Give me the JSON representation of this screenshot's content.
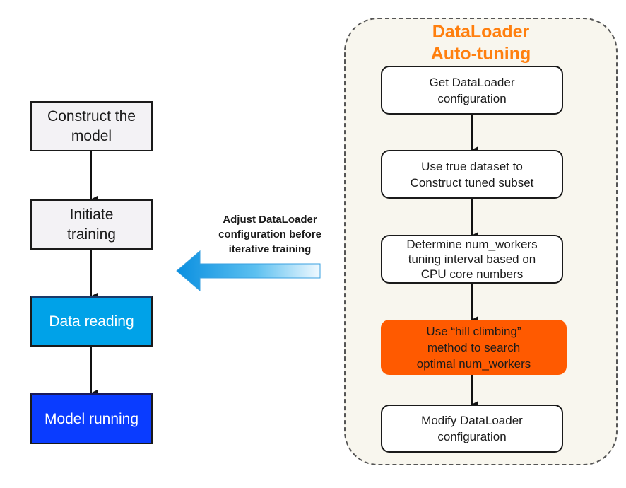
{
  "left_flow": {
    "steps": [
      {
        "label": "Construct the model",
        "style": "plain"
      },
      {
        "label": "Initiate training",
        "style": "plain"
      },
      {
        "label": "Data reading",
        "style": "cyan"
      },
      {
        "label": "Model running",
        "style": "blue"
      }
    ]
  },
  "connector": {
    "label": "Adjust DataLoader configuration before iterative training",
    "direction": "left"
  },
  "panel": {
    "title_line1": "DataLoader",
    "title_line2": "Auto-tuning",
    "steps": [
      {
        "line1": "Get DataLoader",
        "line2": "configuration"
      },
      {
        "line1": "Use true dataset to",
        "line2": "Construct tuned subset"
      },
      {
        "line1": "Determine num_workers",
        "line2": "tuning interval based on",
        "line3": "CPU core numbers"
      },
      {
        "line1": "Use “hill climbing”",
        "line2": "method to search",
        "line3": "optimal num_workers",
        "highlight": true
      },
      {
        "line1": "Modify DataLoader",
        "line2": "configuration"
      }
    ]
  },
  "colors": {
    "panel_title": "#ff7f0e",
    "highlight_step": "#ff5a00",
    "data_reading": "#00a2e8",
    "model_running": "#0a3cff",
    "panel_bg": "#f8f6ee"
  }
}
